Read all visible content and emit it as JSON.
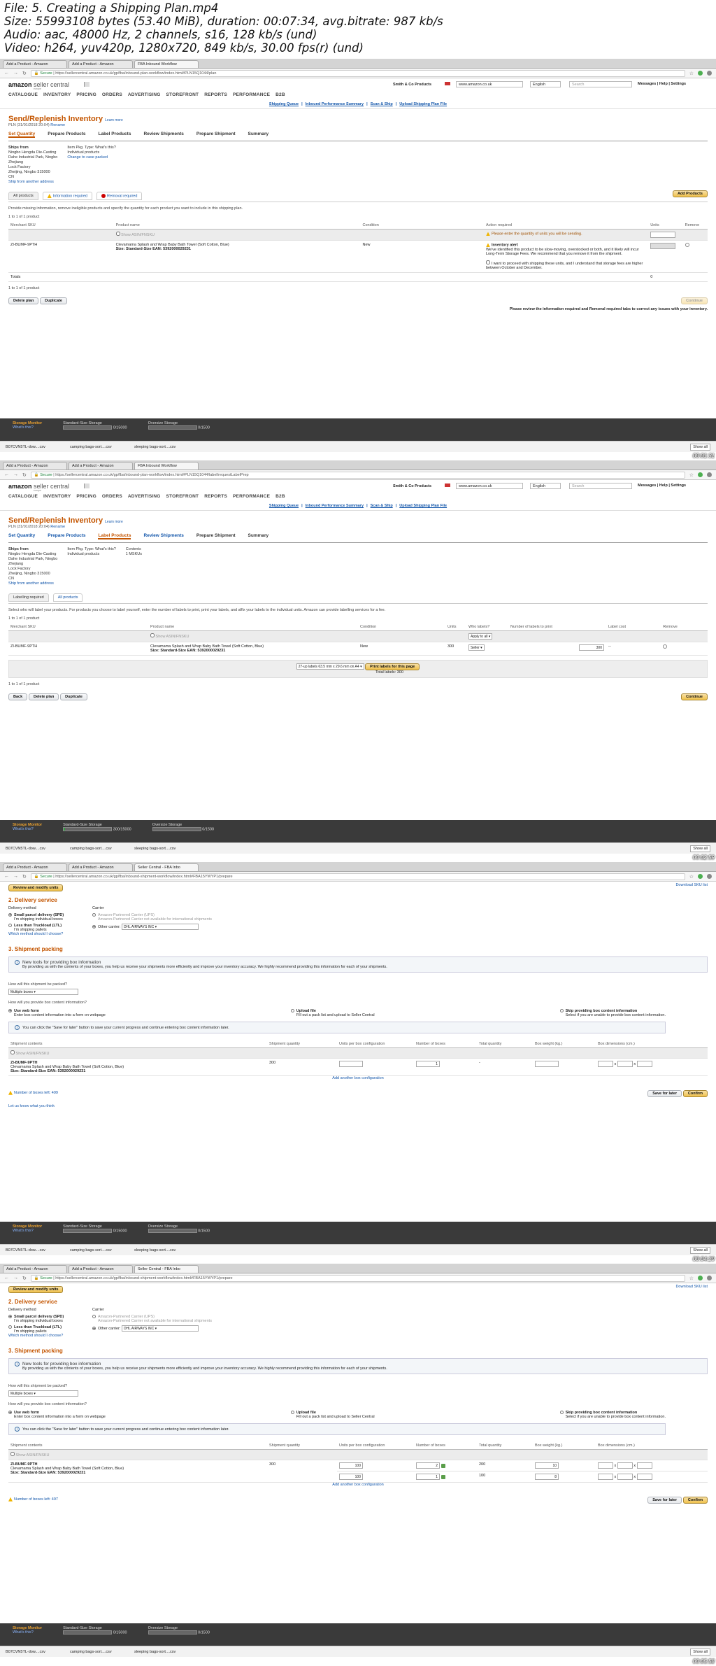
{
  "video_info": [
    "File: 5. Creating a Shipping Plan.mp4",
    "Size: 55993108 bytes (53.40 MiB), duration: 00:07:34, avg.bitrate: 987 kb/s",
    "Audio: aac, 48000 Hz, 2 channels, s16, 128 kb/s (und)",
    "Video: h264, yuv420p, 1280x720, 849 kb/s, 30.00 fps(r) (und)"
  ],
  "common": {
    "acct": "Smith & Co Products",
    "marketplace": "www.amazon.co.uk",
    "language": "English",
    "search_placeholder": "Search",
    "help_links": "Messages | Help | Settings",
    "logo_main": "amazon",
    "logo_rest": " seller central",
    "logo_sub": "europe",
    "nav": [
      "CATALOGUE",
      "INVENTORY",
      "PRICING",
      "ORDERS",
      "ADVERTISING",
      "STOREFRONT",
      "REPORTS",
      "PERFORMANCE",
      "B2B"
    ],
    "sublinks": [
      "Shipping Queue",
      "Inbound Performance Summary",
      "Scan & Ship",
      "Upload Shipping Plan File"
    ],
    "title": "Send/Replenish Inventory",
    "learn": "Learn more",
    "plan": "PLN (31/01/2018 20:04)",
    "rename": "Rename",
    "steps": [
      "Set Quantity",
      "Prepare Products",
      "Label Products",
      "Review Shipments",
      "Prepare Shipment",
      "Summary"
    ],
    "ships_from_label": "Ships from",
    "ships_from": [
      "Ningbo Hengda Die-Casting",
      "Dahe Industrial Park, Ningbo",
      "Zhejiang",
      "Lock Factory",
      "Zheijing, Ningbo 315000",
      "CN"
    ],
    "ship_another": "Ship from another address",
    "pkg_label": "Item Pkg. Type: What's this?",
    "pkg_value": "Individual products",
    "change_pkg": "Change to case packed",
    "sku": "ZI-BUMF-9PTH",
    "product": "Clevamama Splash and Wrap Baby Bath Towel (Soft Cotton, Blue)",
    "size_ean": "Size: Standard-Size EAN: 5392000029231",
    "show_asin": "Show ASIN/FNSKU",
    "condition": "New",
    "storage_title": "Storage Monitor",
    "whats": "What's this?",
    "std": "Standard-Size Storage",
    "over": "Oversize Storage",
    "std_val": "0/15000",
    "over_val": "0/1500",
    "downloads": [
      "B07CVN5TL-dow....csv",
      "camping bags-sort....csv",
      "sleeping bags-sort....csv"
    ],
    "show_all": "Show all",
    "review_units": "Review and modify units",
    "delivery": "2. Delivery service",
    "del_method": "Delivery method",
    "carrier": "Carrier",
    "spd": "Small parcel delivery (SPD)",
    "spd_sub": "I'm shipping individual boxes",
    "ltl": "Less than Truckload (LTL)",
    "ltl_sub": "I'm shipping pallets",
    "which": "Which method should I choose?",
    "amz_carrier": "Amazon-Partnered Carrier (UPS)",
    "amz_carrier_sub": "Amazon-Partnered Carrier not available for international shipments",
    "other": "Other carrier:",
    "other_val": "DHL AIRWAYS INC",
    "packing": "3. Shipment packing",
    "tools_t": "New tools for providing box information",
    "tools_s": "By providing us with the contents of your boxes, you help us receive your shipments more efficiently and improve your inventory accuracy. We highly recommend providing this information for each of your shipments.",
    "packed_q": "How will this shipment be packed?",
    "multi": "Multiple boxes",
    "provide_q": "How will you provide box content information?",
    "web": "Use web form",
    "web_sub": "Enter box content information into a form on webpage",
    "upload": "Upload file",
    "upload_sub": "Fill out a pack list and upload to Seller Central",
    "skip": "Skip providing box content information",
    "skip_sub": "Select if you are unable to provide box content information.",
    "save_info": "You can click the \"Save for later\" button to save your current progress and continue entering box content information later.",
    "box_cols": [
      "Shipment contents",
      "Shipment quantity",
      "Units per box configuration",
      "Number of boxes",
      "Total quantity",
      "Box weight (kg.)",
      "Box dimensions (cm.)"
    ],
    "add_cfg": "Add another box configuration",
    "save_later": "Save for later",
    "confirm": "Confirm",
    "dl_sku": "Download SKU list",
    "let_us": "Let us know what you think",
    "qty300": "300"
  },
  "f1": {
    "tabs": [
      "Add a Product - Amazon",
      "Add a Product - Amazon",
      "FBA Inbound Workflow"
    ],
    "url": "https://sellercentral.amazon.co.uk/gp/fba/inbound-plan-workflow/index.html#PLN15Q1044/plan",
    "subtabs": [
      "All products",
      "Information required",
      "Removal required"
    ],
    "add_products": "Add Products",
    "instr": "Provide missing information, remove ineligible products and specify the quantity for each product you want to include in this shipping plan.",
    "count": "1 to 1 of 1 product",
    "cols": [
      "Merchant SKU",
      "Product name",
      "Condition",
      "Action required",
      "Units",
      "Remove"
    ],
    "enter_qty": "Please enter the quantity of units you will be sending.",
    "alert_t": "Inventory alert",
    "alert_b": "We've identified this product to be slow-moving, overstocked or both, and it likely will incur Long-Term Storage Fees. We recommend that you remove it from the shipment.",
    "ack": "I want to proceed with shipping these units, and I understand that storage fees are higher between October and December.",
    "totals": "Totals",
    "zero": "0",
    "delete": "Delete plan",
    "duplicate": "Duplicate",
    "continue": "Continue",
    "review": "Please review the information required and Removal required tabs to correct any issues with your inventory.",
    "ts": "00:01:31"
  },
  "f2": {
    "tabs": [
      "Add a Product - Amazon",
      "Add a Product - Amazon",
      "FBA Inbound Workflow"
    ],
    "url": "https://sellercentral.amazon.co.uk/gp/fba/inbound-plan-workflow/index.html#PLN15Q1044/label/requestLabelPrep",
    "contents_label": "Contents",
    "contents": "1 MSKUs",
    "subtabs": [
      "Labelling required",
      "All products"
    ],
    "instr": "Select who will label your products. For products you choose to label yourself, enter the number of labels to print, print your labels, and affix your labels to the individual units. Amazon can provide labelling services for a fee.",
    "count": "1 to 1 of 1 product",
    "cols": [
      "Merchant SKU",
      "Product name",
      "Condition",
      "Units",
      "Who labels?",
      "Number of labels to print",
      "Label cost",
      "Remove"
    ],
    "apply_all": "Apply to all",
    "seller": "Seller",
    "labels": "300",
    "dash": "--",
    "fmt": "27-up labels 63.5 mm x 29.6 mm on A4",
    "print": "Print labels for this page",
    "total_labels": "Total labels: 300",
    "back": "Back",
    "delete": "Delete plan",
    "duplicate": "Duplicate",
    "continue": "Continue",
    "std_val": "300/15000",
    "ts": "00:02:59"
  },
  "f3": {
    "tabs": [
      "Add a Product - Amazon",
      "Add a Product - Amazon",
      "Seller Central - FBA Inbo"
    ],
    "url": "https://sellercentral.amazon.co.uk/gp/fba/inbound-shipment-workflow/index.html#FBA15YWYP1/prepare",
    "units": "",
    "boxes": "1",
    "boxes_left": "Number of boxes left: 499",
    "ts": "00:04:29"
  },
  "f4": {
    "tabs": [
      "Add a Product - Amazon",
      "Add a Product - Amazon",
      "Seller Central - FBA Inbo"
    ],
    "url": "https://sellercentral.amazon.co.uk/gp/fba/inbound-shipment-workflow/index.html#FBA15YWYP1/prepare",
    "rows": [
      {
        "units": "100",
        "boxes": "2",
        "total": "200",
        "weight": "10"
      },
      {
        "units": "100",
        "boxes": "1",
        "total": "100",
        "weight": "8"
      }
    ],
    "boxes_left": "Number of boxes left: 497",
    "ts": "00:05:58"
  }
}
